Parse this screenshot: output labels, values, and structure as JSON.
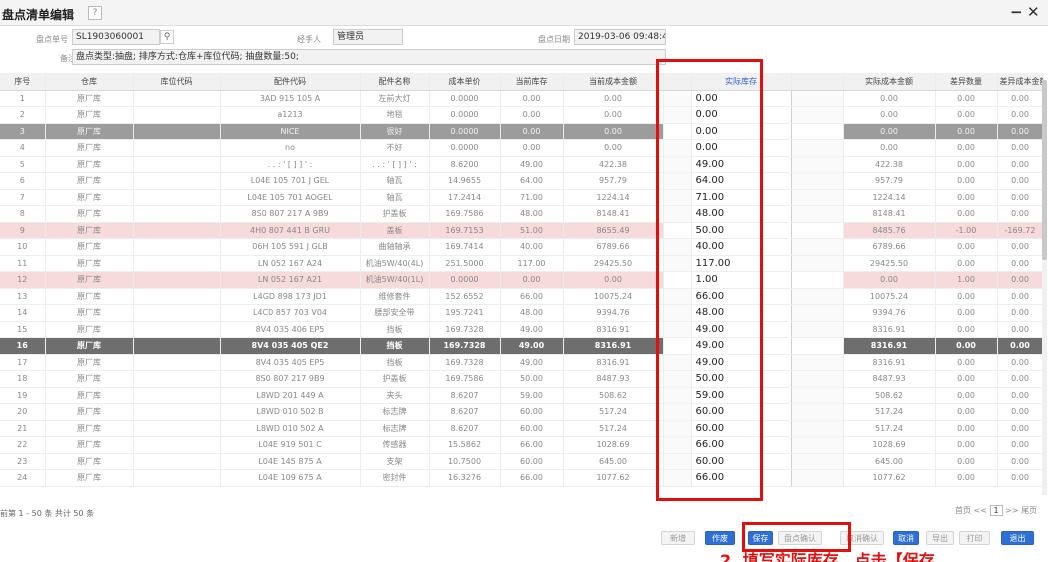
{
  "window": {
    "title": "盘点清单编辑",
    "help": "?",
    "minimize": "−",
    "close": "✕"
  },
  "header": {
    "order_no_label": "盘点单号",
    "order_no": "SL1903060001",
    "search_icon": "search-icon",
    "search_glyph": "⚲",
    "operator_label": "经手人",
    "operator": "管理员",
    "date_label": "盘点日期",
    "date": "2019-03-06 09:48:4(",
    "remark_label": "备注",
    "remark": "盘点类型:抽盘; 排序方式:仓库+库位代码; 抽盘数量:50;"
  },
  "columns": [
    "序号",
    "仓库",
    "库位代码",
    "配件代码",
    "配件名称",
    "成本单价",
    "当前库存",
    "当前成本金额",
    "",
    "实际库存",
    "",
    "实际成本金额",
    "差异数量",
    "差异成本金额"
  ],
  "rows": [
    {
      "no": "1",
      "wh": "原厂库",
      "loc": "",
      "code": "3AD 915 105 A",
      "name": "左前大灯",
      "price": "0.0000",
      "stock": "0.00",
      "amount": "0.00",
      "actual": "0.00",
      "actual_amount": "0.00",
      "diff_qty": "0.00",
      "diff_amount": "0.00",
      "state": ""
    },
    {
      "no": "2",
      "wh": "原厂库",
      "loc": "",
      "code": "a1213",
      "name": "地毯",
      "price": "0.0000",
      "stock": "0.00",
      "amount": "0.00",
      "actual": "0.00",
      "actual_amount": "0.00",
      "diff_qty": "0.00",
      "diff_amount": "0.00",
      "state": ""
    },
    {
      "no": "3",
      "wh": "原厂库",
      "loc": "",
      "code": "NICE",
      "name": "很好",
      "price": "0.0000",
      "stock": "0.00",
      "amount": "0.00",
      "actual": "0.00",
      "actual_amount": "0.00",
      "diff_qty": "0.00",
      "diff_amount": "0.00",
      "state": "sel"
    },
    {
      "no": "4",
      "wh": "原厂库",
      "loc": "",
      "code": "no",
      "name": "不好",
      "price": "0.0000",
      "stock": "0.00",
      "amount": "0.00",
      "actual": "0.00",
      "actual_amount": "0.00",
      "diff_qty": "0.00",
      "diff_amount": "0.00",
      "state": ""
    },
    {
      "no": "5",
      "wh": "原厂库",
      "loc": "",
      "code": ". . : ' [ ] ] ' :",
      "name": ". . : ' [ ] ] ' :",
      "price": "8.6200",
      "stock": "49.00",
      "amount": "422.38",
      "actual": "49.00",
      "actual_amount": "422.38",
      "diff_qty": "0.00",
      "diff_amount": "0.00",
      "state": ""
    },
    {
      "no": "6",
      "wh": "原厂库",
      "loc": "",
      "code": "L04E 105 701 J GEL",
      "name": "轴瓦",
      "price": "14.9655",
      "stock": "64.00",
      "amount": "957.79",
      "actual": "64.00",
      "actual_amount": "957.79",
      "diff_qty": "0.00",
      "diff_amount": "0.00",
      "state": ""
    },
    {
      "no": "7",
      "wh": "原厂库",
      "loc": "",
      "code": "L04E 105 701 AOGEL",
      "name": "轴瓦",
      "price": "17.2414",
      "stock": "71.00",
      "amount": "1224.14",
      "actual": "71.00",
      "actual_amount": "1224.14",
      "diff_qty": "0.00",
      "diff_amount": "0.00",
      "state": ""
    },
    {
      "no": "8",
      "wh": "原厂库",
      "loc": "",
      "code": "8S0 807 217 A 9B9",
      "name": "护盖板",
      "price": "169.7586",
      "stock": "48.00",
      "amount": "8148.41",
      "actual": "48.00",
      "actual_amount": "8148.41",
      "diff_qty": "0.00",
      "diff_amount": "0.00",
      "state": ""
    },
    {
      "no": "9",
      "wh": "原厂库",
      "loc": "",
      "code": "4H0 807 441 B GRU",
      "name": "盖板",
      "price": "169.7153",
      "stock": "51.00",
      "amount": "8655.49",
      "actual": "50.00",
      "actual_amount": "8485.76",
      "diff_qty": "-1.00",
      "diff_amount": "-169.72",
      "state": "pink"
    },
    {
      "no": "10",
      "wh": "原厂库",
      "loc": "",
      "code": "06H 105 591 J GLB",
      "name": "曲轴轴承",
      "price": "169.7414",
      "stock": "40.00",
      "amount": "6789.66",
      "actual": "40.00",
      "actual_amount": "6789.66",
      "diff_qty": "0.00",
      "diff_amount": "0.00",
      "state": ""
    },
    {
      "no": "11",
      "wh": "原厂库",
      "loc": "",
      "code": "LN  052 167 A24",
      "name": "机油5W/40(4L)",
      "price": "251.5000",
      "stock": "117.00",
      "amount": "29425.50",
      "actual": "117.00",
      "actual_amount": "29425.50",
      "diff_qty": "0.00",
      "diff_amount": "0.00",
      "state": ""
    },
    {
      "no": "12",
      "wh": "原厂库",
      "loc": "",
      "code": "LN  052 167 A21",
      "name": "机油5W/40(1L)",
      "price": "0.0000",
      "stock": "0.00",
      "amount": "0.00",
      "actual": "1.00",
      "actual_amount": "0.00",
      "diff_qty": "1.00",
      "diff_amount": "0.00",
      "state": "pink"
    },
    {
      "no": "13",
      "wh": "原厂库",
      "loc": "",
      "code": "L4GD 898 173 JD1",
      "name": "维修套件",
      "price": "152.6552",
      "stock": "66.00",
      "amount": "10075.24",
      "actual": "66.00",
      "actual_amount": "10075.24",
      "diff_qty": "0.00",
      "diff_amount": "0.00",
      "state": ""
    },
    {
      "no": "14",
      "wh": "原厂库",
      "loc": "",
      "code": "L4C0 857 703 V04",
      "name": "腰部安全带",
      "price": "195.7241",
      "stock": "48.00",
      "amount": "9394.76",
      "actual": "48.00",
      "actual_amount": "9394.76",
      "diff_qty": "0.00",
      "diff_amount": "0.00",
      "state": ""
    },
    {
      "no": "15",
      "wh": "原厂库",
      "loc": "",
      "code": "8V4 035 406 EP5",
      "name": "挡板",
      "price": "169.7328",
      "stock": "49.00",
      "amount": "8316.91",
      "actual": "49.00",
      "actual_amount": "8316.91",
      "diff_qty": "0.00",
      "diff_amount": "0.00",
      "state": ""
    },
    {
      "no": "16",
      "wh": "原厂库",
      "loc": "",
      "code": "8V4 035 405 QE2",
      "name": "挡板",
      "price": "169.7328",
      "stock": "49.00",
      "amount": "8316.91",
      "actual": "49.00",
      "actual_amount": "8316.91",
      "diff_qty": "0.00",
      "diff_amount": "0.00",
      "state": "dark"
    },
    {
      "no": "17",
      "wh": "原厂库",
      "loc": "",
      "code": "8V4 035 405 EP5",
      "name": "挡板",
      "price": "169.7328",
      "stock": "49.00",
      "amount": "8316.91",
      "actual": "49.00",
      "actual_amount": "8316.91",
      "diff_qty": "0.00",
      "diff_amount": "0.00",
      "state": ""
    },
    {
      "no": "18",
      "wh": "原厂库",
      "loc": "",
      "code": "8S0 807 217 9B9",
      "name": "护盖板",
      "price": "169.7586",
      "stock": "50.00",
      "amount": "8487.93",
      "actual": "50.00",
      "actual_amount": "8487.93",
      "diff_qty": "0.00",
      "diff_amount": "0.00",
      "state": ""
    },
    {
      "no": "19",
      "wh": "原厂库",
      "loc": "",
      "code": "L8WD 201 449 A",
      "name": "夹头",
      "price": "8.6207",
      "stock": "59.00",
      "amount": "508.62",
      "actual": "59.00",
      "actual_amount": "508.62",
      "diff_qty": "0.00",
      "diff_amount": "0.00",
      "state": ""
    },
    {
      "no": "20",
      "wh": "原厂库",
      "loc": "",
      "code": "L8WD 010 502 B",
      "name": "标志牌",
      "price": "8.6207",
      "stock": "60.00",
      "amount": "517.24",
      "actual": "60.00",
      "actual_amount": "517.24",
      "diff_qty": "0.00",
      "diff_amount": "0.00",
      "state": ""
    },
    {
      "no": "21",
      "wh": "原厂库",
      "loc": "",
      "code": "L8WD 010 502 A",
      "name": "标志牌",
      "price": "8.6207",
      "stock": "60.00",
      "amount": "517.24",
      "actual": "60.00",
      "actual_amount": "517.24",
      "diff_qty": "0.00",
      "diff_amount": "0.00",
      "state": ""
    },
    {
      "no": "22",
      "wh": "原厂库",
      "loc": "",
      "code": "L04E 919 501 C",
      "name": "传感器",
      "price": "15.5862",
      "stock": "66.00",
      "amount": "1028.69",
      "actual": "66.00",
      "actual_amount": "1028.69",
      "diff_qty": "0.00",
      "diff_amount": "0.00",
      "state": ""
    },
    {
      "no": "23",
      "wh": "原厂库",
      "loc": "",
      "code": "L04E 145 875 A",
      "name": "支架",
      "price": "10.7500",
      "stock": "60.00",
      "amount": "645.00",
      "actual": "60.00",
      "actual_amount": "645.00",
      "diff_qty": "0.00",
      "diff_amount": "0.00",
      "state": ""
    },
    {
      "no": "24",
      "wh": "原厂库",
      "loc": "",
      "code": "L04E 109 675 A",
      "name": "密封件",
      "price": "16.3276",
      "stock": "66.00",
      "amount": "1077.62",
      "actual": "66.00",
      "actual_amount": "1077.62",
      "diff_qty": "0.00",
      "diff_amount": "0.00",
      "state": ""
    }
  ],
  "footer": {
    "summary": "前第 1 - 50 条  共计 50 条",
    "first": "首页",
    "prev": "<<",
    "page": "1",
    "next": ">>",
    "last": "尾页"
  },
  "buttons": [
    {
      "label": "新增",
      "style": "gray",
      "name": "add-button"
    },
    {
      "label": "作废",
      "style": "blue",
      "name": "void-button"
    },
    {
      "label": "保存",
      "style": "blue",
      "name": "save-button"
    },
    {
      "label": "盘点确认",
      "style": "gray",
      "name": "confirm-count-button"
    },
    {
      "label": "取消确认",
      "style": "gray",
      "name": "cancel-confirm-button"
    },
    {
      "label": "取消",
      "style": "blue",
      "name": "cancel-button"
    },
    {
      "label": "导出",
      "style": "gray",
      "name": "export-button"
    },
    {
      "label": "打印",
      "style": "gray",
      "name": "print-button"
    },
    {
      "label": "退出",
      "style": "blue",
      "name": "exit-button"
    }
  ],
  "annotation": "2. 填写实际库存，点击【保存"
}
